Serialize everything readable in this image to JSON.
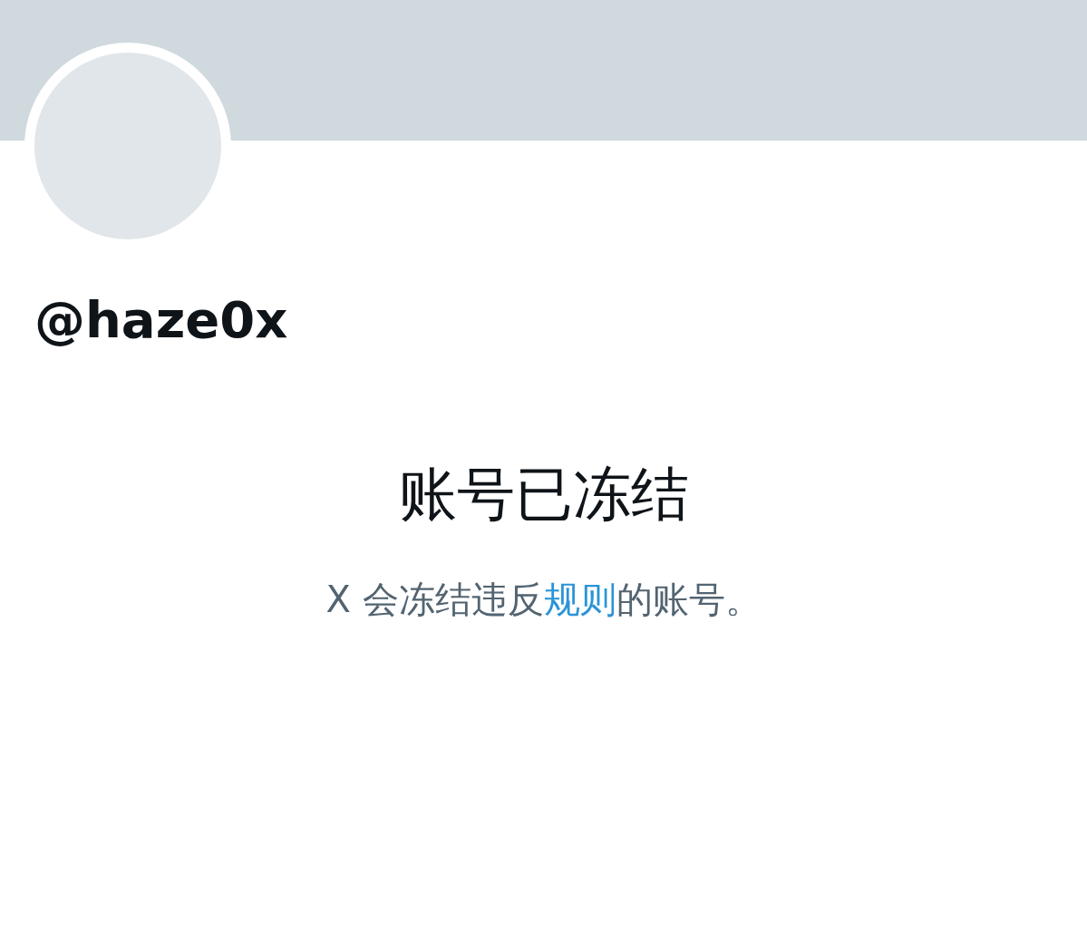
{
  "profile": {
    "handle": "@haze0x"
  },
  "notice": {
    "title": "账号已冻结",
    "message_before": "X 会冻结违反",
    "link": "规则",
    "message_after": "的账号。"
  }
}
